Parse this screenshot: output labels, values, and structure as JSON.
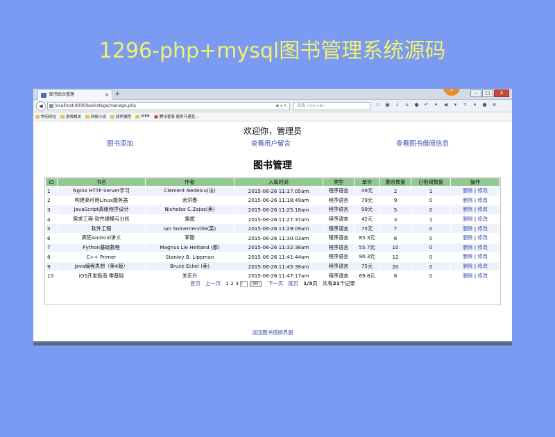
{
  "headline": "1296-php+mysql图书管理系统源码",
  "browser": {
    "tab_title": "图书后台管理",
    "url": "localhost:8090/backstage/manage.php",
    "search_placeholder": "百度 <Ctrl+K>",
    "bookmarks": [
      "常用网址",
      "游戏相关",
      "网络小说",
      "软件编程",
      "WEB",
      "腾讯客服-服务开通查..."
    ]
  },
  "page": {
    "welcome": "欢迎你，管理员",
    "links": [
      "图书添加",
      "查看用户留言",
      "查看图书借阅信息"
    ],
    "title": "图书管理",
    "columns": [
      "ID",
      "书名",
      "作者",
      "入库时间",
      "类型",
      "单价",
      "剩余数量",
      "已借阅数量",
      "操作"
    ],
    "rows": [
      [
        "1",
        "Nginx HTTP Server学习",
        "Clement Nedelcu(法)",
        "2015-06-26 11:17:05am",
        "程序语言",
        "49元",
        "2",
        "1"
      ],
      [
        "2",
        "构建高可用Linux服务器",
        "余洪春",
        "2015-06-26 11:18:49am",
        "程序语言",
        "79元",
        "9",
        "0"
      ],
      [
        "3",
        "JavaScript高级程序设计",
        "Nicholas C.Zajas(美)",
        "2015-06-26 11:25:18am",
        "程序语言",
        "99元",
        "5",
        "0"
      ],
      [
        "4",
        "需求工程-软件建模与分析",
        "骆斌",
        "2015-06-26 11:27:37am",
        "程序语言",
        "42元",
        "3",
        "1"
      ],
      [
        "5",
        "软件工程",
        "Ian Somemerville(英)",
        "2015-06-26 11:29:09am",
        "程序语言",
        "75元",
        "7",
        "0"
      ],
      [
        "6",
        "疯狂Android讲义",
        "李刚",
        "2015-06-26 11:30:03am",
        "程序语言",
        "85.3元",
        "6",
        "0"
      ],
      [
        "7",
        "Python基础教程",
        "Magnus Lie Hetland (挪)",
        "2015-06-26 11:32:38am",
        "程序语言",
        "55.7元",
        "10",
        "0"
      ],
      [
        "8",
        "C++ Primer",
        "Stanley B. Lippman",
        "2015-06-26 11:41:44am",
        "程序语言",
        "90.3元",
        "12",
        "0"
      ],
      [
        "9",
        "Java编程思想（第4版）",
        "Bruce Eckel (美)",
        "2015-06-26 11:45:38am",
        "程序语言",
        "75元",
        "20",
        "0"
      ],
      [
        "10",
        "iOS开发指南 零基础",
        "关东升",
        "2015-06-26 11:47:17am",
        "程序语言",
        "69.8元",
        "8",
        "0"
      ]
    ],
    "op_delete": "删除",
    "op_sep": "|",
    "op_edit": "修改",
    "pager": {
      "first": "首页",
      "prev": "上一页",
      "pages": [
        "1",
        "2",
        "3"
      ],
      "input_value": "1",
      "go": "GO",
      "next": "下一页",
      "last": "尾页",
      "current": "1/3",
      "page_suffix": "页",
      "total_prefix": "共有",
      "total": "21",
      "total_suffix": "个记录"
    },
    "return_link": "返回图书借阅界面"
  }
}
